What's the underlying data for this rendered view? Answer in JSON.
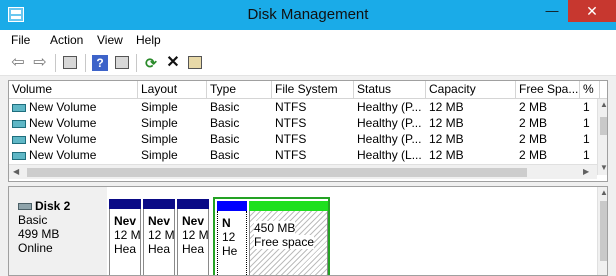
{
  "window": {
    "title": "Disk Management",
    "minimize": "—",
    "close": "✕"
  },
  "menu": [
    "File",
    "Action",
    "View",
    "Help"
  ],
  "columns": [
    "Volume",
    "Layout",
    "Type",
    "File System",
    "Status",
    "Capacity",
    "Free Spa...",
    "%"
  ],
  "rows": [
    [
      "New Volume",
      "Simple",
      "Basic",
      "NTFS",
      "Healthy (P...",
      "12 MB",
      "2 MB",
      "1"
    ],
    [
      "New Volume",
      "Simple",
      "Basic",
      "NTFS",
      "Healthy (P...",
      "12 MB",
      "2 MB",
      "1"
    ],
    [
      "New Volume",
      "Simple",
      "Basic",
      "NTFS",
      "Healthy (P...",
      "12 MB",
      "2 MB",
      "1"
    ],
    [
      "New Volume",
      "Simple",
      "Basic",
      "NTFS",
      "Healthy (L...",
      "12 MB",
      "2 MB",
      "1"
    ]
  ],
  "disk": {
    "name": "Disk 2",
    "type": "Basic",
    "size": "499 MB",
    "state": "Online"
  },
  "partitions": [
    {
      "name": "Nev",
      "size": "12 M",
      "status": "Hea"
    },
    {
      "name": "Nev",
      "size": "12 M",
      "status": "Hea"
    },
    {
      "name": "Nev",
      "size": "12 M",
      "status": "Hea"
    },
    {
      "name": "N",
      "size": "12",
      "status": "He"
    }
  ],
  "free_space": {
    "size": "450 MB",
    "label": "Free space"
  },
  "icons": [
    "back-icon",
    "forward-icon",
    "console-tree-icon",
    "help-icon",
    "action-pane-icon",
    "refresh-icon",
    "delete-icon",
    "properties-icon"
  ],
  "colors": {
    "titlebar": "#1aabe8",
    "partition": "#0a0a86",
    "free": "#1ee01e",
    "selection": "#24a224",
    "close": "#c7372f"
  }
}
